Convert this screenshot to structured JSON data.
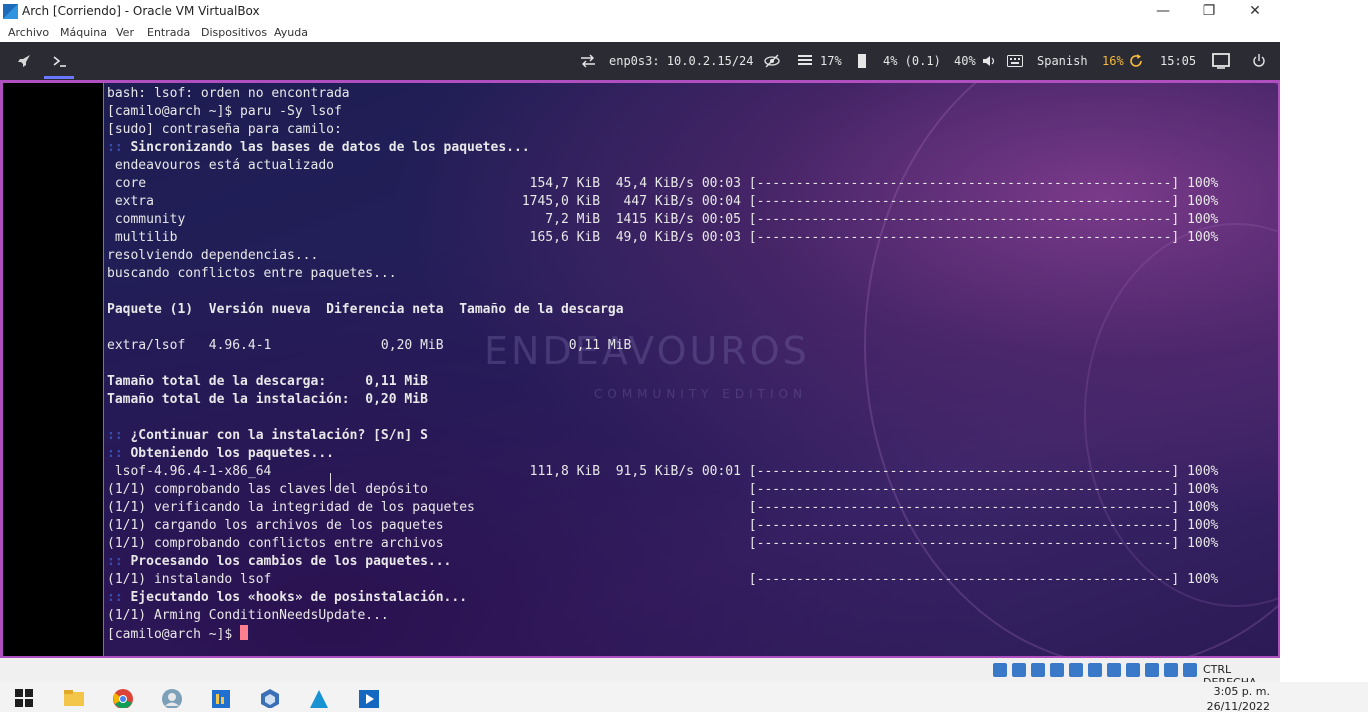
{
  "window": {
    "title": "Arch [Corriendo] - Oracle VM VirtualBox"
  },
  "menu": [
    "Archivo",
    "Máquina",
    "Ver",
    "Entrada",
    "Dispositivos",
    "Ayuda"
  ],
  "panel": {
    "network": "enp0s3: 10.0.2.15/24",
    "mem": "17%",
    "cpu": "4% (0.1)",
    "volume": "40%",
    "keyboard": "Spanish",
    "updates": "16%",
    "time": "15:05"
  },
  "terminal": {
    "lines": [
      "bash: lsof: orden no encontrada",
      "[camilo@arch ~]$ paru -Sy lsof",
      "[sudo] contraseña para camilo:",
      ":: Sincronizando las bases de datos de los paquetes...",
      " endeavouros está actualizado",
      " core                                                 154,7 KiB  45,4 KiB/s 00:03 [-----------------------------------------------------] 100%",
      " extra                                               1745,0 KiB   447 KiB/s 00:04 [-----------------------------------------------------] 100%",
      " community                                              7,2 MiB  1415 KiB/s 00:05 [-----------------------------------------------------] 100%",
      " multilib                                             165,6 KiB  49,0 KiB/s 00:03 [-----------------------------------------------------] 100%",
      "resolviendo dependencias...",
      "buscando conflictos entre paquetes...",
      "",
      "Paquete (1)  Versión nueva  Diferencia neta  Tamaño de la descarga",
      "",
      "extra/lsof   4.96.4-1              0,20 MiB                0,11 MiB",
      "",
      "Tamaño total de la descarga:     0,11 MiB",
      "Tamaño total de la instalación:  0,20 MiB",
      "",
      ":: ¿Continuar con la instalación? [S/n] S",
      ":: Obteniendo los paquetes...",
      " lsof-4.96.4-1-x86_64                                 111,8 KiB  91,5 KiB/s 00:01 [-----------------------------------------------------] 100%",
      "(1/1) comprobando las claves del depósito                                         [-----------------------------------------------------] 100%",
      "(1/1) verificando la integridad de los paquetes                                   [-----------------------------------------------------] 100%",
      "(1/1) cargando los archivos de los paquetes                                       [-----------------------------------------------------] 100%",
      "(1/1) comprobando conflictos entre archivos                                       [-----------------------------------------------------] 100%",
      ":: Procesando los cambios de los paquetes...",
      "(1/1) instalando lsof                                                             [-----------------------------------------------------] 100%",
      ":: Ejecutando los «hooks» de posinstalación...",
      "(1/1) Arming ConditionNeedsUpdate...",
      "[camilo@arch ~]$ "
    ],
    "bold_lines": [
      3,
      12,
      16,
      17,
      19,
      20,
      26,
      28
    ],
    "watermark": "ENDEAVOUROS",
    "watermark_sub": "COMMUNITY EDITION"
  },
  "vbox_status": {
    "host_key": "CTRL DERECHA"
  },
  "taskbar": {
    "time": "3:05 p. m.",
    "date": "26/11/2022"
  }
}
